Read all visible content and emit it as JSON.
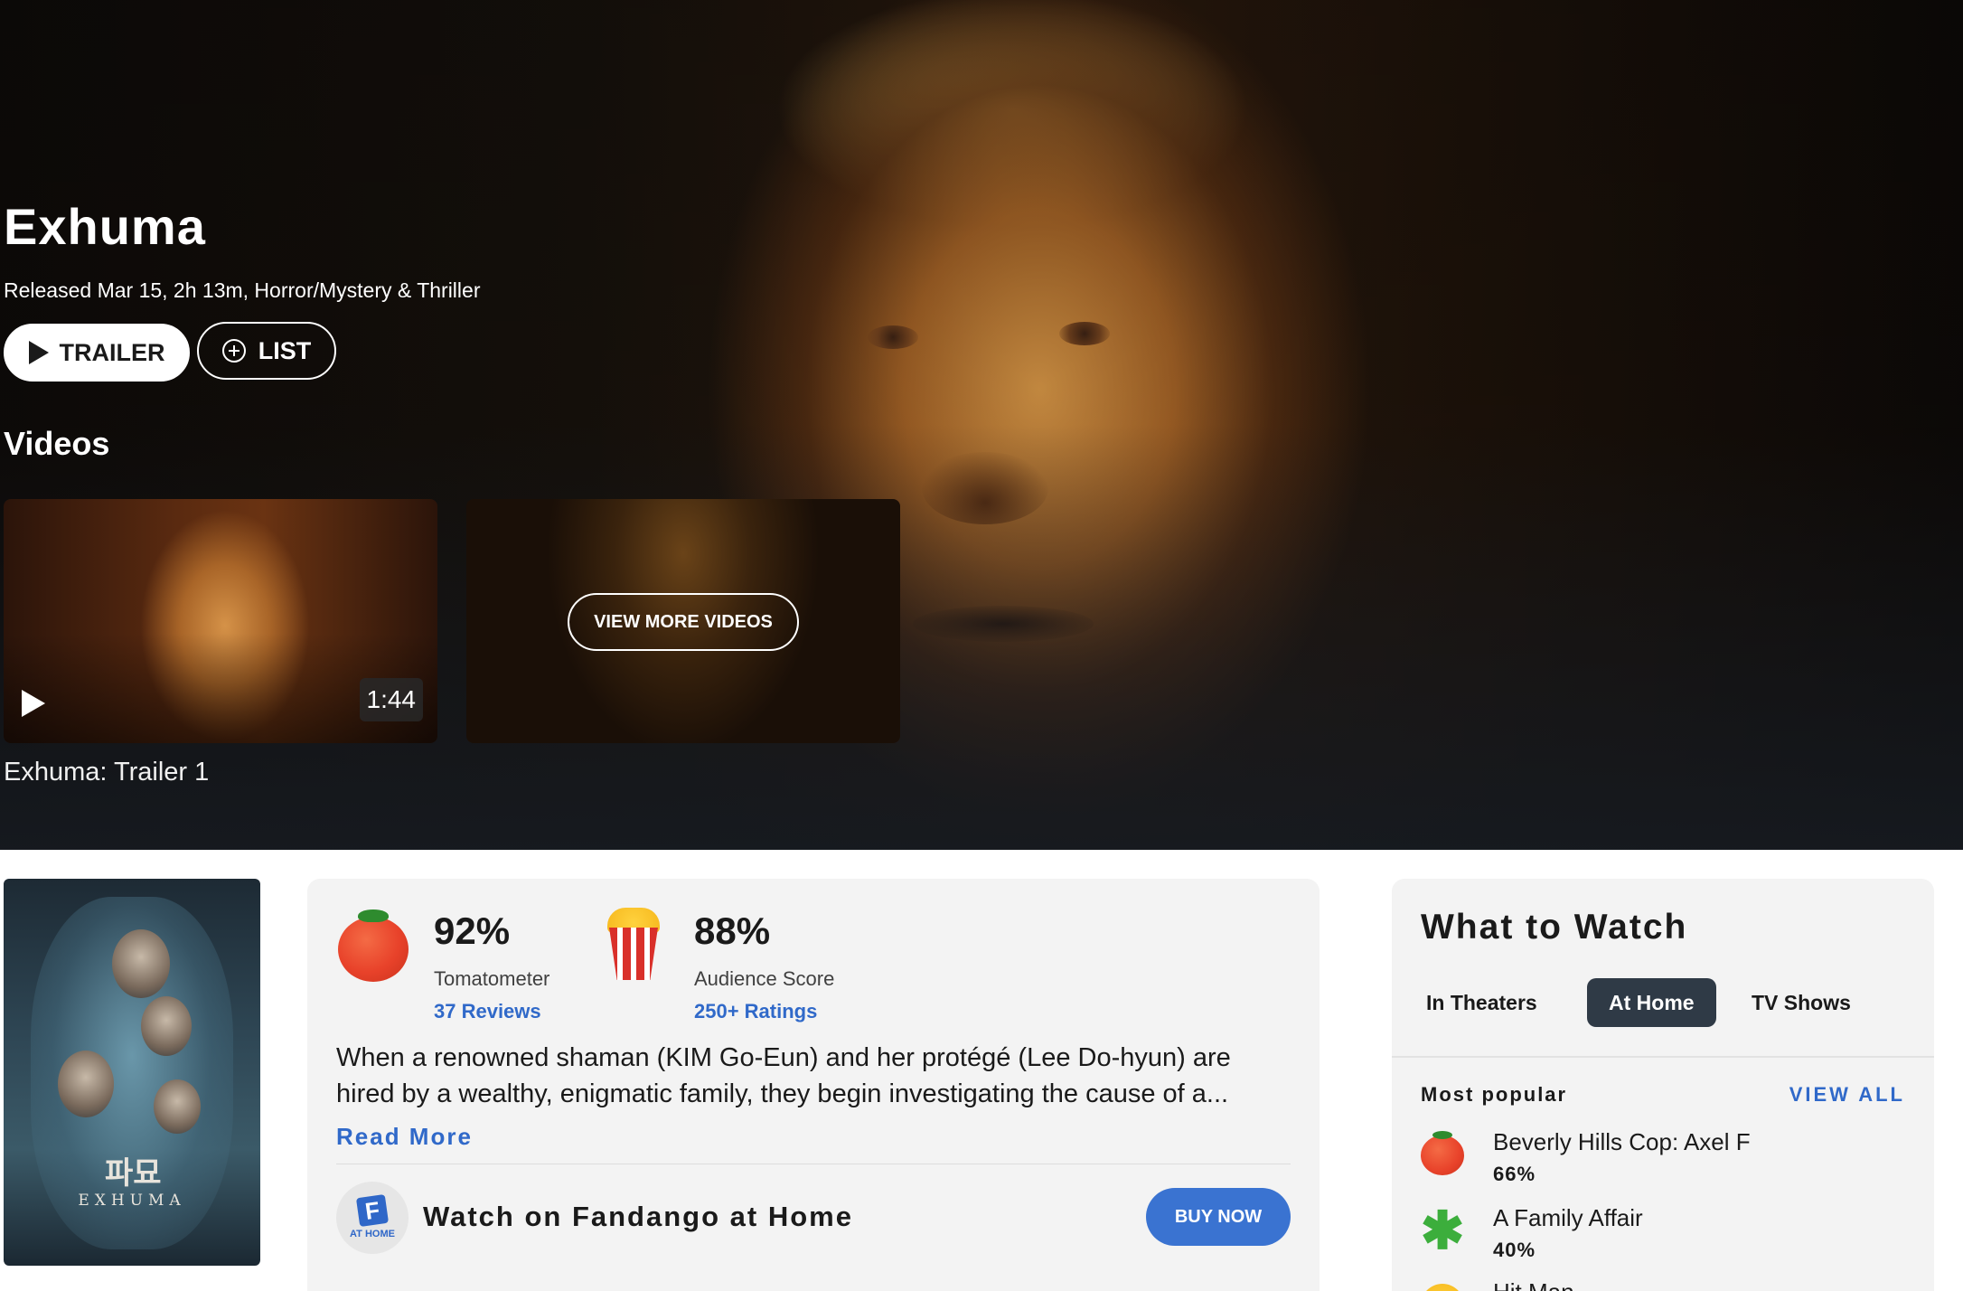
{
  "hero": {
    "title": "Exhuma",
    "meta": "Released Mar 15, 2h 13m, Horror/Mystery & Thriller",
    "trailer_label": "TRAILER",
    "list_label": "LIST"
  },
  "videos": {
    "heading": "Videos",
    "items": [
      {
        "caption": "Exhuma: Trailer 1",
        "duration": "1:44"
      }
    ],
    "view_more_label": "VIEW MORE VIDEOS"
  },
  "poster": {
    "korean_title": "파묘",
    "title_text": "EXHUMA"
  },
  "scores": {
    "tomatometer": {
      "value": "92%",
      "label": "Tomatometer",
      "link": "37 Reviews"
    },
    "audience": {
      "value": "88%",
      "label": "Audience Score",
      "link": "250+ Ratings"
    }
  },
  "synopsis": {
    "text": "When a renowned shaman (KIM Go-Eun) and her protégé (Lee Do-hyun) are hired by a wealthy, enigmatic family, they begin investigating the cause of a...",
    "read_more": "Read More"
  },
  "fandango": {
    "logo_text": "AT HOME",
    "watch_text": "Watch on Fandango at Home",
    "buy_label": "BUY NOW"
  },
  "what_to_watch": {
    "title": "What to Watch",
    "tabs": [
      {
        "label": "In Theaters",
        "active": false
      },
      {
        "label": "At Home",
        "active": true
      },
      {
        "label": "TV Shows",
        "active": false
      }
    ],
    "most_popular_label": "Most popular",
    "view_all_label": "VIEW ALL",
    "items": [
      {
        "title": "Beverly Hills Cop: Axel F",
        "score": "66%",
        "icon": "tomato-icon"
      },
      {
        "title": "A Family Affair",
        "score": "40%",
        "icon": "splat-icon"
      },
      {
        "title": "Hit Man",
        "score": "",
        "icon": "popcorn-icon"
      }
    ]
  },
  "colors": {
    "link_blue": "#3069c9",
    "buy_button": "#3a73d1",
    "active_tab": "#2f3a46",
    "tomato_red": "#e8422a"
  }
}
